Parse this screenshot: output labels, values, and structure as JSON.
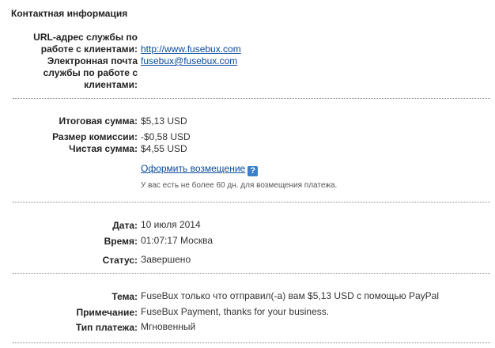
{
  "contact": {
    "title": "Контактная информация",
    "url_label_l1": "URL-адрес службы по",
    "url_label_l2": "работе с клиентами:",
    "url_value": "http://www.fusebux.com",
    "email_label_l1": "Электронная почта",
    "email_label_l2": "службы по работе с",
    "email_label_l3": "клиентами:",
    "email_value": "fusebux@fusebux.com"
  },
  "amounts": {
    "total_label": "Итоговая сумма:",
    "total_value": "$5,13 USD",
    "fee_label": "Размер комиссии:",
    "fee_value": "-$0,58 USD",
    "net_label": "Чистая сумма:",
    "net_value": "$4,55 USD",
    "refund_link": "Оформить возмещение",
    "refund_help_icon": "question-icon",
    "refund_help_glyph": "?",
    "refund_hint": "У вас есть не более 60 дн. для возмещения платежа."
  },
  "details": {
    "date_label": "Дата:",
    "date_value": "10 июля 2014",
    "time_label": "Время:",
    "time_value": "01:07:17 Москва",
    "status_label": "Статус:",
    "status_value": "Завершено"
  },
  "message": {
    "subject_label": "Тема:",
    "subject_value": "FuseBux только что отправил(-а) вам $5,13 USD с помощью PayPal",
    "note_label": "Примечание:",
    "note_value": "FuseBux Payment, thanks for your business.",
    "type_label": "Тип платежа:",
    "type_value": "Мгновенный"
  }
}
